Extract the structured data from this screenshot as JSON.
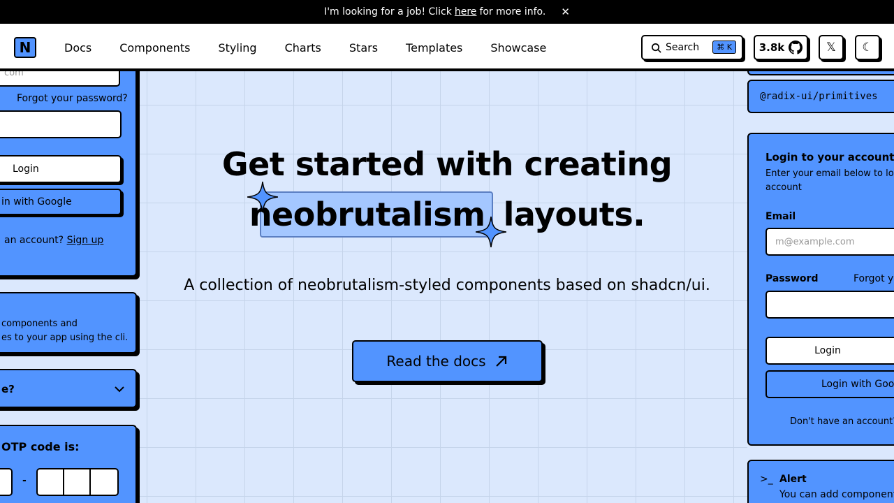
{
  "banner": {
    "text_before": "I'm looking for a job! Click",
    "link": "here",
    "text_after": "for more info.",
    "close": "✕"
  },
  "nav": {
    "logo": "N",
    "links": [
      "Docs",
      "Components",
      "Styling",
      "Charts",
      "Stars",
      "Templates",
      "Showcase"
    ],
    "search_label": "Search",
    "search_kbd": "⌘ K",
    "stars_count": "3.8k",
    "x_icon": "𝕏",
    "theme_icon": "☾"
  },
  "left": {
    "email_partial": "com",
    "forgot": "Forgot your password?",
    "login": "Login",
    "google": "in with Google",
    "no_account": "an account?",
    "signup": "Sign up",
    "cli_line1": "components and",
    "cli_line2": "es to your app using the cli.",
    "accordion": "e?",
    "otp_label": "OTP code is:",
    "otp_sep": "-"
  },
  "hero": {
    "line1": "Get started with creating",
    "highlight": "neobrutalism",
    "line2_rest": "layouts.",
    "subtitle": "A collection of neobrutalism-styled components based on shadcn/ui.",
    "cta": "Read the docs",
    "cta_icon": "↗"
  },
  "right": {
    "package": "@radix-ui/primitives",
    "login_title": "Login to your account",
    "login_desc": "Enter your email below to lo",
    "login_desc2": "account",
    "email_label": "Email",
    "email_placeholder": "m@example.com",
    "password_label": "Password",
    "forgot": "Forgot yo",
    "login": "Login",
    "google": "Login with Goog",
    "no_account": "Don't have an account?",
    "alert_title": "Alert",
    "alert_text": "You can add components"
  }
}
